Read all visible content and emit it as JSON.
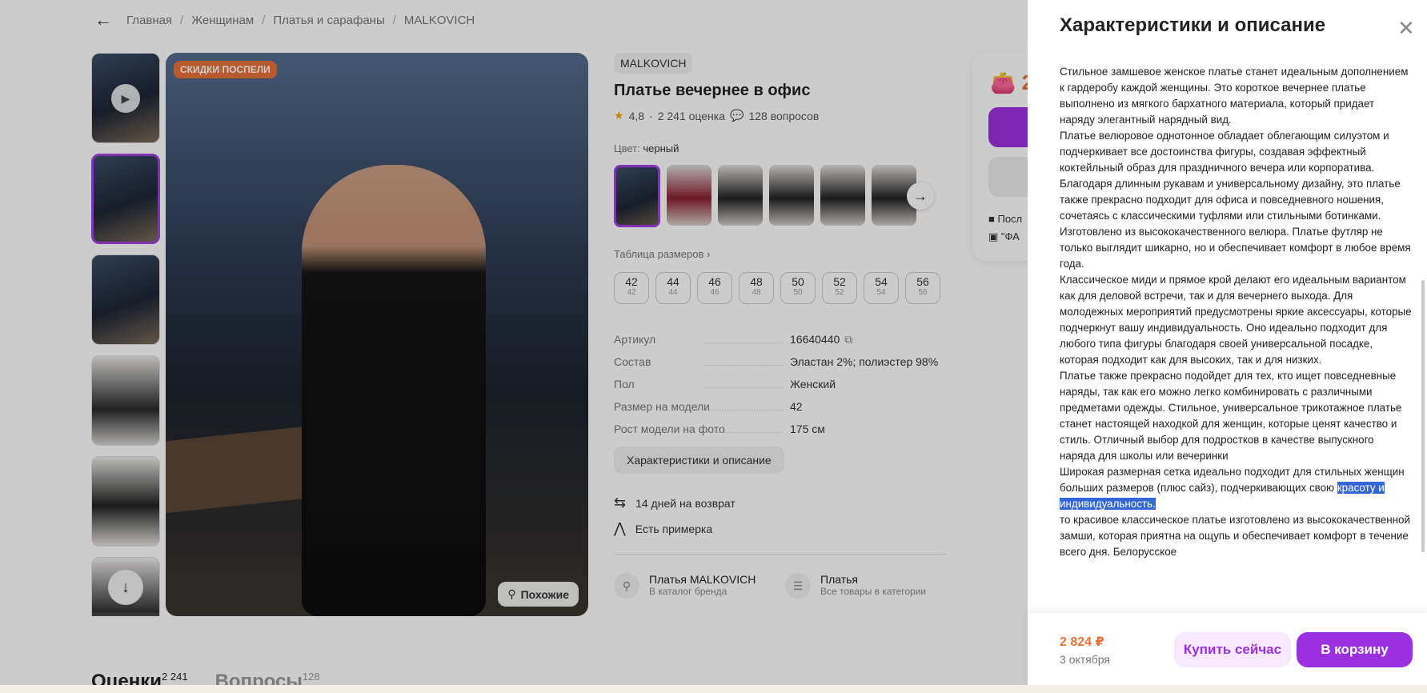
{
  "breadcrumb": {
    "items": [
      "Главная",
      "Женщинам",
      "Платья и сарафаны",
      "MALKOVICH"
    ],
    "separator": "/"
  },
  "gallery": {
    "badge": "СКИДКИ ПОСПЕЛИ",
    "similar_label": "Похожие"
  },
  "product": {
    "brand": "MALKOVICH",
    "title": "Платье вечернее в офис",
    "rating": "4,8",
    "reviews": "2 241 оценка",
    "questions": "128 вопросов",
    "color_label": "Цвет:",
    "color_value": "черный",
    "size_table_link": "Таблица размеров",
    "sizes": [
      {
        "main": "42",
        "sub": "42"
      },
      {
        "main": "44",
        "sub": "44"
      },
      {
        "main": "46",
        "sub": "46"
      },
      {
        "main": "48",
        "sub": "48"
      },
      {
        "main": "50",
        "sub": "50"
      },
      {
        "main": "52",
        "sub": "52"
      },
      {
        "main": "54",
        "sub": "54"
      },
      {
        "main": "56",
        "sub": "56"
      }
    ],
    "specs": [
      {
        "key": "Артикул",
        "value": "16640440"
      },
      {
        "key": "Состав",
        "value": "Эластан 2%; полиэстер 98%"
      },
      {
        "key": "Пол",
        "value": "Женский"
      },
      {
        "key": "Размер на модели",
        "value": "42"
      },
      {
        "key": "Рост модели на фото",
        "value": "175 см"
      }
    ],
    "characteristics_button": "Характеристики и описание",
    "features": [
      "14 дней на возврат",
      "Есть примерка"
    ],
    "links": [
      {
        "title": "Платья MALKOVICH",
        "sub": "В каталог бренда"
      },
      {
        "title": "Платья",
        "sub": "Все товары в категории"
      }
    ]
  },
  "bottom_tabs": [
    {
      "label": "Оценки",
      "count": "2 241"
    },
    {
      "label": "Вопросы",
      "count": "128"
    }
  ],
  "pricebox": {
    "price_partial": "2",
    "line1": "Посл",
    "line2": "\"ФА"
  },
  "drawer": {
    "title": "Характеристики и описание",
    "paragraphs": [
      "Стильное замшевое женское платье станет идеальным дополнением к гардеробу каждой женщины. Это короткое вечернее платье выполнено из мягкого бархатного материала, который придает наряду элегантный нарядный вид.",
      "Платье велюровое однотонное обладает облегающим силуэтом и подчеркивает все достоинства фигуры, создавая эффектный коктейльный образ для праздничного вечера или корпоратива. Благодаря длинным рукавам и универсальному дизайну, это платье также прекрасно подходит для офиса и повседневного ношения, сочетаясь с классическими туфлями или стильными ботинками.",
      "Изготовлено из высококачественного велюра. Платье футляр не только выглядит шикарно, но и обеспечивает комфорт в любое время года.",
      "Классическое миди и прямое крой делают его идеальным вариантом как для деловой встречи, так и для вечернего выхода. Для молодежных мероприятий предусмотрены яркие аксессуары, которые подчеркнут вашу индивидуальность. Оно идеально подходит для любого типа фигуры благодаря своей универсальной посадке, которая подходит как для высоких, так и для низких.",
      "Платье также прекрасно подойдет для тех, кто ищет повседневные наряды, так как его можно легко комбинировать с различными предметами одежды. Стильное, универсальное трикотажное платье станет настоящей находкой для женщин, которые ценят качество и стиль. Отличный выбор для подростков в качестве выпускного наряда для школы или вечеринки"
    ],
    "para6_plain": "Широкая размерная сетка идеально подходит для стильных женщин больших размеров (плюс сайз), подчеркивающих свою ",
    "para6_highlight": "красоту и индивидуальность.",
    "para7": "то красивое классическое платье изготовлено из высококачественной замши, которая приятна на ощупь и обеспечивает комфорт в течение всего дня. Белорусское",
    "footer": {
      "price": "2 824 ₽",
      "date": "3 октября",
      "buy_now": "Купить сейчас",
      "add_to_cart": "В корзину"
    }
  },
  "colors": {
    "accent": "#9b30e0",
    "price": "#e8703a",
    "highlight": "#3367d6"
  }
}
